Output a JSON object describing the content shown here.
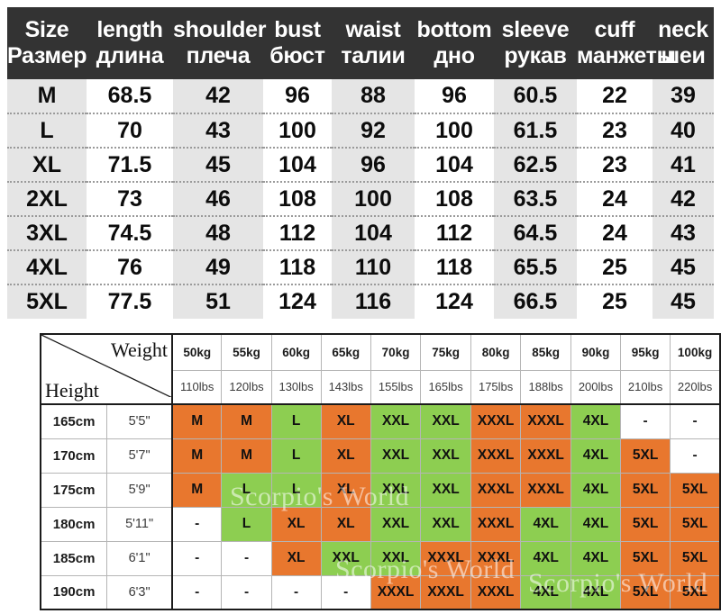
{
  "size_chart": {
    "columns": [
      {
        "en": "Size",
        "ru": "Размер"
      },
      {
        "en": "length",
        "ru": "длина"
      },
      {
        "en": "shoulder",
        "ru": "плеча"
      },
      {
        "en": "bust",
        "ru": "бюст"
      },
      {
        "en": "waist",
        "ru": "талии"
      },
      {
        "en": "bottom",
        "ru": "дно"
      },
      {
        "en": "sleeve",
        "ru": "рукав"
      },
      {
        "en": "cuff",
        "ru": "манжеты"
      },
      {
        "en": "neck",
        "ru": "шеи"
      }
    ],
    "rows": [
      [
        "M",
        "68.5",
        "42",
        "96",
        "88",
        "96",
        "60.5",
        "22",
        "39"
      ],
      [
        "L",
        "70",
        "43",
        "100",
        "92",
        "100",
        "61.5",
        "23",
        "40"
      ],
      [
        "XL",
        "71.5",
        "45",
        "104",
        "96",
        "104",
        "62.5",
        "23",
        "41"
      ],
      [
        "2XL",
        "73",
        "46",
        "108",
        "100",
        "108",
        "63.5",
        "24",
        "42"
      ],
      [
        "3XL",
        "74.5",
        "48",
        "112",
        "104",
        "112",
        "64.5",
        "24",
        "43"
      ],
      [
        "4XL",
        "76",
        "49",
        "118",
        "110",
        "118",
        "65.5",
        "25",
        "45"
      ],
      [
        "5XL",
        "77.5",
        "51",
        "124",
        "116",
        "124",
        "66.5",
        "25",
        "45"
      ]
    ]
  },
  "fit_grid": {
    "corner": {
      "weight_label": "Weight",
      "height_label": "Height"
    },
    "weights_kg": [
      "50kg",
      "55kg",
      "60kg",
      "65kg",
      "70kg",
      "75kg",
      "80kg",
      "85kg",
      "90kg",
      "95kg",
      "100kg"
    ],
    "weights_lbs": [
      "110lbs",
      "120lbs",
      "130lbs",
      "143lbs",
      "155lbs",
      "165lbs",
      "175lbs",
      "188lbs",
      "200lbs",
      "210lbs",
      "220lbs"
    ],
    "heights": [
      {
        "cm": "165cm",
        "inch": "5'5\""
      },
      {
        "cm": "170cm",
        "inch": "5'7\""
      },
      {
        "cm": "175cm",
        "inch": "5'9\""
      },
      {
        "cm": "180cm",
        "inch": "5'11\""
      },
      {
        "cm": "185cm",
        "inch": "6'1\""
      },
      {
        "cm": "190cm",
        "inch": "6'3\""
      }
    ],
    "cells": [
      [
        {
          "v": "M",
          "c": "orange"
        },
        {
          "v": "M",
          "c": "orange"
        },
        {
          "v": "L",
          "c": "green"
        },
        {
          "v": "XL",
          "c": "orange"
        },
        {
          "v": "XXL",
          "c": "green"
        },
        {
          "v": "XXL",
          "c": "green"
        },
        {
          "v": "XXXL",
          "c": "orange"
        },
        {
          "v": "XXXL",
          "c": "orange"
        },
        {
          "v": "4XL",
          "c": "green"
        },
        {
          "v": "-",
          "c": "none"
        },
        {
          "v": "-",
          "c": "none"
        }
      ],
      [
        {
          "v": "M",
          "c": "orange"
        },
        {
          "v": "M",
          "c": "orange"
        },
        {
          "v": "L",
          "c": "green"
        },
        {
          "v": "XL",
          "c": "orange"
        },
        {
          "v": "XXL",
          "c": "green"
        },
        {
          "v": "XXL",
          "c": "green"
        },
        {
          "v": "XXXL",
          "c": "orange"
        },
        {
          "v": "XXXL",
          "c": "orange"
        },
        {
          "v": "4XL",
          "c": "green"
        },
        {
          "v": "5XL",
          "c": "orange"
        },
        {
          "v": "-",
          "c": "none"
        }
      ],
      [
        {
          "v": "M",
          "c": "orange"
        },
        {
          "v": "L",
          "c": "green"
        },
        {
          "v": "L",
          "c": "green"
        },
        {
          "v": "XL",
          "c": "orange"
        },
        {
          "v": "XXL",
          "c": "green"
        },
        {
          "v": "XXL",
          "c": "green"
        },
        {
          "v": "XXXL",
          "c": "orange"
        },
        {
          "v": "XXXL",
          "c": "orange"
        },
        {
          "v": "4XL",
          "c": "green"
        },
        {
          "v": "5XL",
          "c": "orange"
        },
        {
          "v": "5XL",
          "c": "orange"
        }
      ],
      [
        {
          "v": "-",
          "c": "none"
        },
        {
          "v": "L",
          "c": "green"
        },
        {
          "v": "XL",
          "c": "orange"
        },
        {
          "v": "XL",
          "c": "orange"
        },
        {
          "v": "XXL",
          "c": "green"
        },
        {
          "v": "XXL",
          "c": "green"
        },
        {
          "v": "XXXL",
          "c": "orange"
        },
        {
          "v": "4XL",
          "c": "green"
        },
        {
          "v": "4XL",
          "c": "green"
        },
        {
          "v": "5XL",
          "c": "orange"
        },
        {
          "v": "5XL",
          "c": "orange"
        }
      ],
      [
        {
          "v": "-",
          "c": "none"
        },
        {
          "v": "-",
          "c": "none"
        },
        {
          "v": "XL",
          "c": "orange"
        },
        {
          "v": "XXL",
          "c": "green"
        },
        {
          "v": "XXL",
          "c": "green"
        },
        {
          "v": "XXXL",
          "c": "orange"
        },
        {
          "v": "XXXL",
          "c": "orange"
        },
        {
          "v": "4XL",
          "c": "green"
        },
        {
          "v": "4XL",
          "c": "green"
        },
        {
          "v": "5XL",
          "c": "orange"
        },
        {
          "v": "5XL",
          "c": "orange"
        }
      ],
      [
        {
          "v": "-",
          "c": "none"
        },
        {
          "v": "-",
          "c": "none"
        },
        {
          "v": "-",
          "c": "none"
        },
        {
          "v": "-",
          "c": "none"
        },
        {
          "v": "XXXL",
          "c": "orange"
        },
        {
          "v": "XXXL",
          "c": "orange"
        },
        {
          "v": "XXXL",
          "c": "orange"
        },
        {
          "v": "4XL",
          "c": "green"
        },
        {
          "v": "4XL",
          "c": "green"
        },
        {
          "v": "5XL",
          "c": "orange"
        },
        {
          "v": "5XL",
          "c": "orange"
        }
      ]
    ]
  },
  "watermark": {
    "text": "Scorpio's World"
  },
  "colors": {
    "header_bg": "#333333",
    "shade_col": "#e5e5e5",
    "orange": "#e8772e",
    "green": "#8dce51",
    "grid_line": "#b5b5b5",
    "frame": "#1b1b1b"
  }
}
